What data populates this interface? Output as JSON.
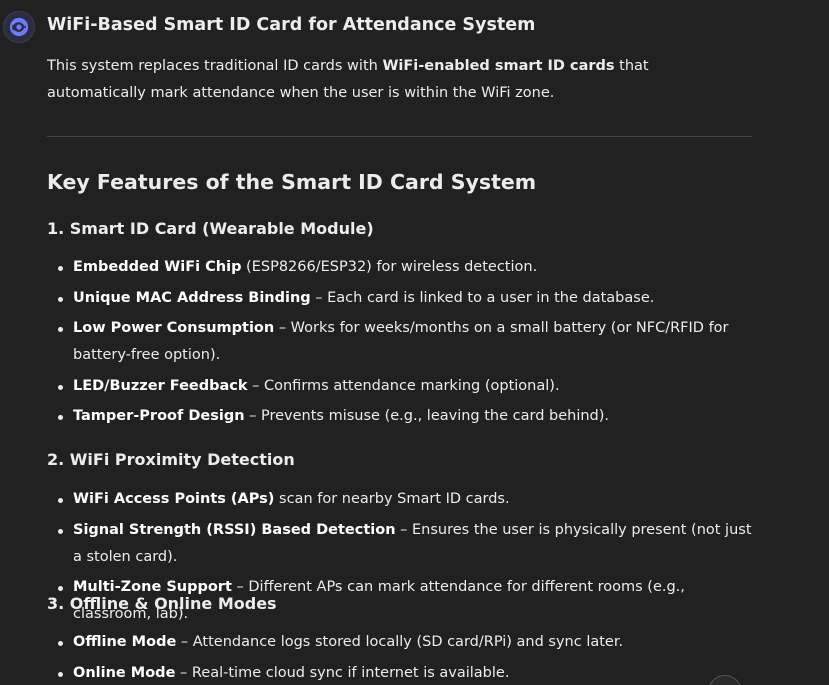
{
  "header": {
    "avatar_icon": "chatgpt-logo-icon",
    "title": "WiFi-Based Smart ID Card for Attendance System"
  },
  "intro": {
    "part1": "This system replaces traditional ID cards with ",
    "bold": "WiFi-enabled smart ID cards",
    "part2": " that automatically mark attendance when the user is within the WiFi zone."
  },
  "section": {
    "heading": "Key Features of the Smart ID Card System"
  },
  "subsections": [
    {
      "heading": "1. Smart ID Card (Wearable Module)",
      "items": [
        {
          "bold": "Embedded WiFi Chip",
          "text": " (ESP8266/ESP32) for wireless detection."
        },
        {
          "bold": "Unique MAC Address Binding",
          "text": " – Each card is linked to a user in the database."
        },
        {
          "bold": "Low Power Consumption",
          "text": " – Works for weeks/months on a small battery (or NFC/RFID for battery-free option)."
        },
        {
          "bold": "LED/Buzzer Feedback",
          "text": " – Confirms attendance marking (optional)."
        },
        {
          "bold": "Tamper-Proof Design",
          "text": " – Prevents misuse (e.g., leaving the card behind)."
        }
      ]
    },
    {
      "heading": "2. WiFi Proximity Detection",
      "items": [
        {
          "bold": "WiFi Access Points (APs)",
          "text": " scan for nearby Smart ID cards."
        },
        {
          "bold": "Signal Strength (RSSI) Based Detection",
          "text": " – Ensures the user is physically present (not just a stolen card)."
        },
        {
          "bold": "Multi-Zone Support",
          "text": " – Different APs can mark attendance for different rooms (e.g., classroom, lab)."
        }
      ]
    },
    {
      "heading": "3. Offline & Online Modes",
      "items": [
        {
          "bold": "Offline Mode",
          "text": " – Attendance logs stored locally (SD card/RPi) and sync later."
        },
        {
          "bold": "Online Mode",
          "text": " – Real-time cloud sync if internet is available."
        }
      ]
    }
  ],
  "scroll_button": {
    "icon": "arrow-down-icon"
  }
}
